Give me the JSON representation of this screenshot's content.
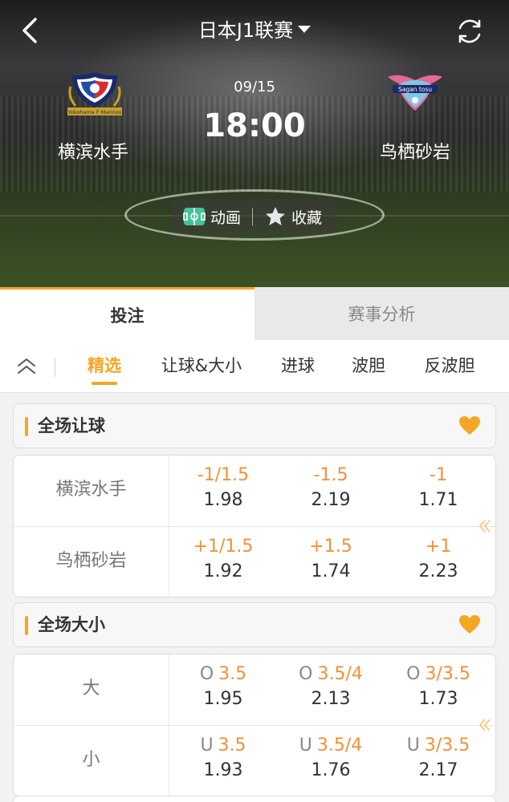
{
  "header": {
    "league": "日本J1联赛",
    "date": "09/15",
    "time": "18:00",
    "home_team": "横滨水手",
    "away_team": "鸟栖砂岩",
    "home_logo_text": "Yokohama F·Marinos",
    "away_logo_text": "Sagan tosu",
    "actions": {
      "animation": "动画",
      "favorite": "收藏"
    }
  },
  "main_tabs": {
    "bet": "投注",
    "analysis": "赛事分析"
  },
  "sub_tabs": [
    "精选",
    "让球&大小",
    "进球",
    "波胆",
    "反波胆"
  ],
  "handicap": {
    "title": "全场让球",
    "rows": [
      {
        "label": "横滨水手",
        "cells": [
          {
            "line": "-1/1.5",
            "odds": "1.98"
          },
          {
            "line": "-1.5",
            "odds": "2.19"
          },
          {
            "line": "-1",
            "odds": "1.71"
          }
        ]
      },
      {
        "label": "鸟栖砂岩",
        "cells": [
          {
            "line": "+1/1.5",
            "odds": "1.92"
          },
          {
            "line": "+1.5",
            "odds": "1.74"
          },
          {
            "line": "+1",
            "odds": "2.23"
          }
        ]
      }
    ]
  },
  "totals": {
    "title": "全场大小",
    "rows": [
      {
        "label": "大",
        "cells": [
          {
            "prefix": "O",
            "line": "3.5",
            "odds": "1.95"
          },
          {
            "prefix": "O",
            "line": "3.5/4",
            "odds": "2.13"
          },
          {
            "prefix": "O",
            "line": "3/3.5",
            "odds": "1.73"
          }
        ]
      },
      {
        "label": "小",
        "cells": [
          {
            "prefix": "U",
            "line": "3.5",
            "odds": "1.93"
          },
          {
            "prefix": "U",
            "line": "3.5/4",
            "odds": "1.76"
          },
          {
            "prefix": "U",
            "line": "3/3.5",
            "odds": "2.17"
          }
        ]
      }
    ]
  },
  "colors": {
    "accent": "#f5a623",
    "line_text": "#f0913a",
    "odds_text": "#333333",
    "home_logo_navy": "#1a2a6c",
    "away_logo_pink": "#e8679a"
  }
}
